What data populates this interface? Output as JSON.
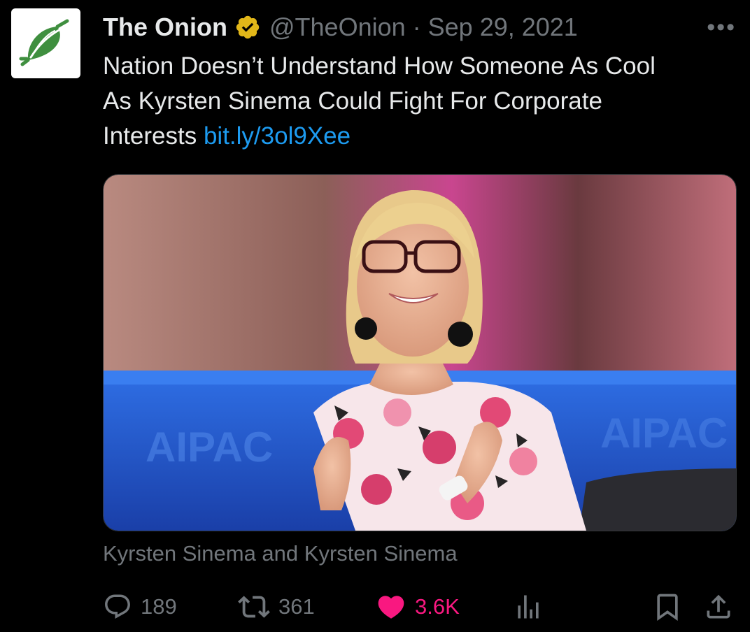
{
  "tweet": {
    "author_name": "The Onion",
    "handle": "@TheOnion",
    "separator": "·",
    "date": "Sep 29, 2021",
    "more_label": "•••",
    "text_line1": "Nation Doesn’t Understand How Someone As Cool",
    "text_line2": "As Kyrsten Sinema Could Fight For Corporate",
    "text_line3": "Interests",
    "link": "bit.ly/3ol9Xee",
    "image_logo_text": "AIPAC",
    "caption": "Kyrsten Sinema and Kyrsten Sinema"
  },
  "actions": {
    "replies": "189",
    "retweets": "361",
    "likes": "3.6K"
  },
  "icons": {
    "avatar": "onion-logo-icon",
    "verified": "verified-badge-icon",
    "reply": "reply-icon",
    "retweet": "retweet-icon",
    "like": "heart-icon",
    "views": "analytics-icon",
    "bookmark": "bookmark-icon",
    "share": "share-icon"
  },
  "colors": {
    "background": "#000000",
    "text": "#e7e9ea",
    "muted": "#71767b",
    "link": "#1d9bf0",
    "like": "#f91880",
    "verified": "#e2b719",
    "logo_green": "#3f8f3f"
  }
}
